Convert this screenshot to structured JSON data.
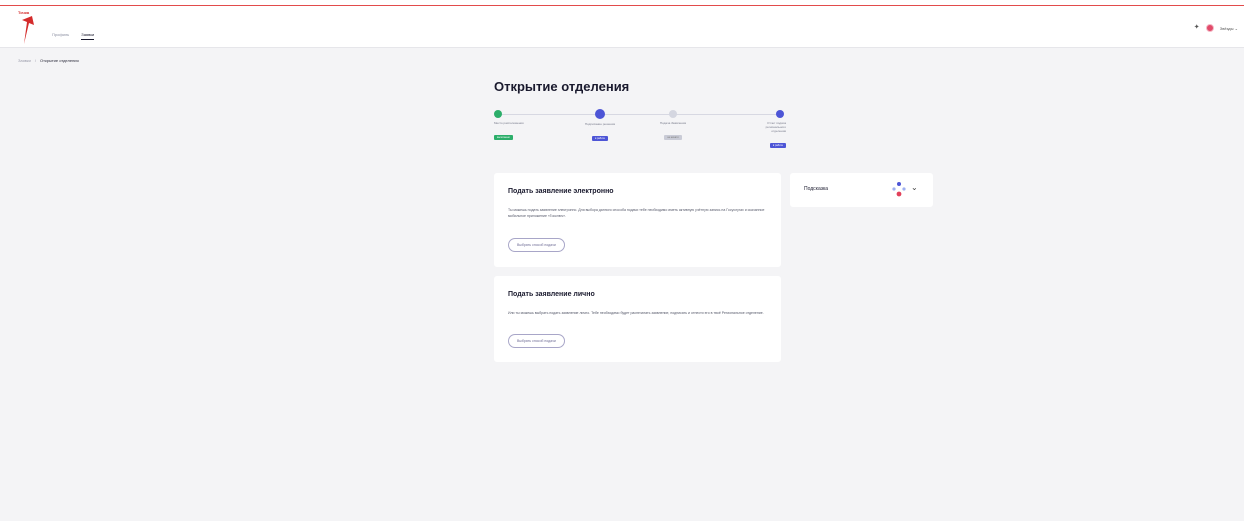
{
  "header": {
    "logo_text": "Точка",
    "nav": [
      {
        "label": "Профиль"
      },
      {
        "label": "Заявки"
      }
    ],
    "user_name": "Звёзды"
  },
  "breadcrumb": {
    "root": "Заявки",
    "separator": "/",
    "current": "Открытие отделения"
  },
  "page": {
    "title": "Открытие отделения"
  },
  "stepper": {
    "steps": [
      {
        "label": "Место расположения",
        "status": "выполнено",
        "color": "#2cae6a",
        "badge_color": "#2cae6a"
      },
      {
        "label": "Подписание решения",
        "status": "в работе",
        "color": "#4d55d6",
        "badge_color": "#4d55d6"
      },
      {
        "label": "Подача Заявления",
        "status": "не начато",
        "color": "#d4d6e0",
        "badge_color": "#c9cbd6"
      },
      {
        "label": "Отчет подача регионального отделения",
        "status": "в работе",
        "color": "#4d55d6",
        "badge_color": "#4d55d6"
      }
    ]
  },
  "cards": [
    {
      "title": "Подать заявление электронно",
      "text": "Ты можешь подать заявление электронно. Для выбора данного способа подачи тебе необходимо иметь активную учётную запись на Госуслугах и скачанное мобильное приложение «Госключ».",
      "button": "Выбрать способ подачи"
    },
    {
      "title": "Подать заявление лично",
      "text": "Или ты можешь выбрать подать заявление лично. Тебе необходимо будет распечатать заявление, подписать и отнести его в твоё Региональное отделение.",
      "button": "Выбрать способ подачи"
    }
  ],
  "hint": {
    "label": "Подсказка",
    "icon": "assistant-icon",
    "chevron": "chevron-down-icon"
  },
  "colors": {
    "accent": "#4d55d6",
    "success": "#2cae6a",
    "brand_red": "#d42b2b"
  }
}
